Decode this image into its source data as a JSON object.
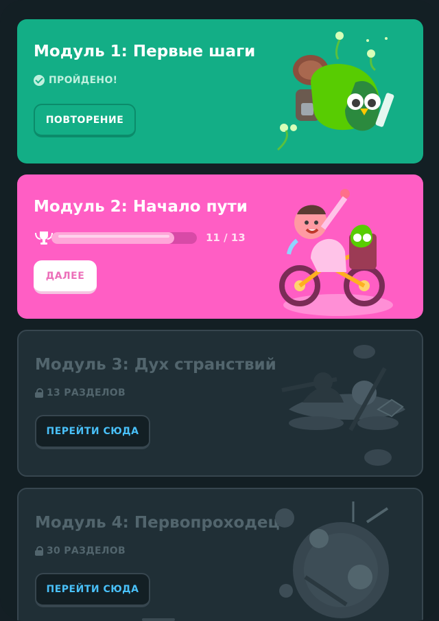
{
  "units": [
    {
      "title": "Модуль 1: Первые шаги",
      "status": "ПРОЙДЕНО!",
      "button": "ПОВТОРЕНИЕ"
    },
    {
      "title": "Модуль 2: Начало пути",
      "progress": {
        "current": 11,
        "total": 13,
        "label": "11 / 13",
        "fraction": 0.846
      },
      "button": "ДАЛЕЕ"
    },
    {
      "title": "Модуль 3: Дух странствий",
      "locked_label": "13 РАЗДЕЛОВ",
      "button": "ПЕРЕЙТИ СЮДА"
    },
    {
      "title": "Модуль 4: Первопроходец",
      "locked_label": "30 РАЗДЕЛОВ",
      "button": "ПЕРЕЙТИ СЮДА"
    }
  ],
  "icons": {
    "completed": "check-circle-icon",
    "trophy": "trophy-icon",
    "locked": "lock-icon"
  },
  "colors": {
    "background": "#131f24",
    "unit1": "#13ae86",
    "unit2": "#ff5ec4",
    "locked_card": "#202f36",
    "link_blue": "#49c0f8"
  }
}
